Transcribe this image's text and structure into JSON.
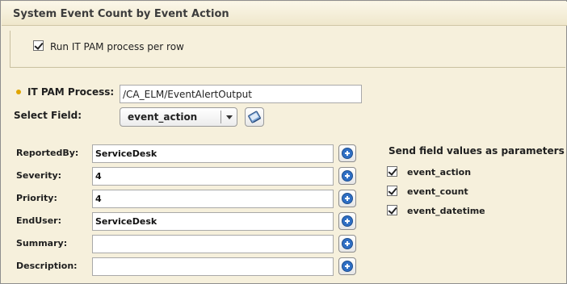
{
  "panel": {
    "title": "System Event Count by Event Action",
    "run_per_row": {
      "label": "Run IT PAM process per row",
      "checked": true
    }
  },
  "process": {
    "label": "IT PAM Process:",
    "value": "/CA_ELM/EventAlertOutput"
  },
  "select_field": {
    "label": "Select Field:",
    "value": "event_action",
    "icon": "book-icon"
  },
  "params": [
    {
      "label": "ReportedBy:",
      "value": "ServiceDesk"
    },
    {
      "label": "Severity:",
      "value": "4"
    },
    {
      "label": "Priority:",
      "value": "4"
    },
    {
      "label": "EndUser:",
      "value": "ServiceDesk"
    },
    {
      "label": "Summary:",
      "value": ""
    },
    {
      "label": "Description:",
      "value": ""
    }
  ],
  "send_fields": {
    "heading": "Send field values as parameters",
    "items": [
      {
        "label": "event_action",
        "checked": true
      },
      {
        "label": "event_count",
        "checked": true
      },
      {
        "label": "event_datetime",
        "checked": true
      }
    ]
  },
  "colors": {
    "panel_bg": "#f6f0dc",
    "required_dot": "#e0a500",
    "plus_icon": "#2f6fc4"
  }
}
